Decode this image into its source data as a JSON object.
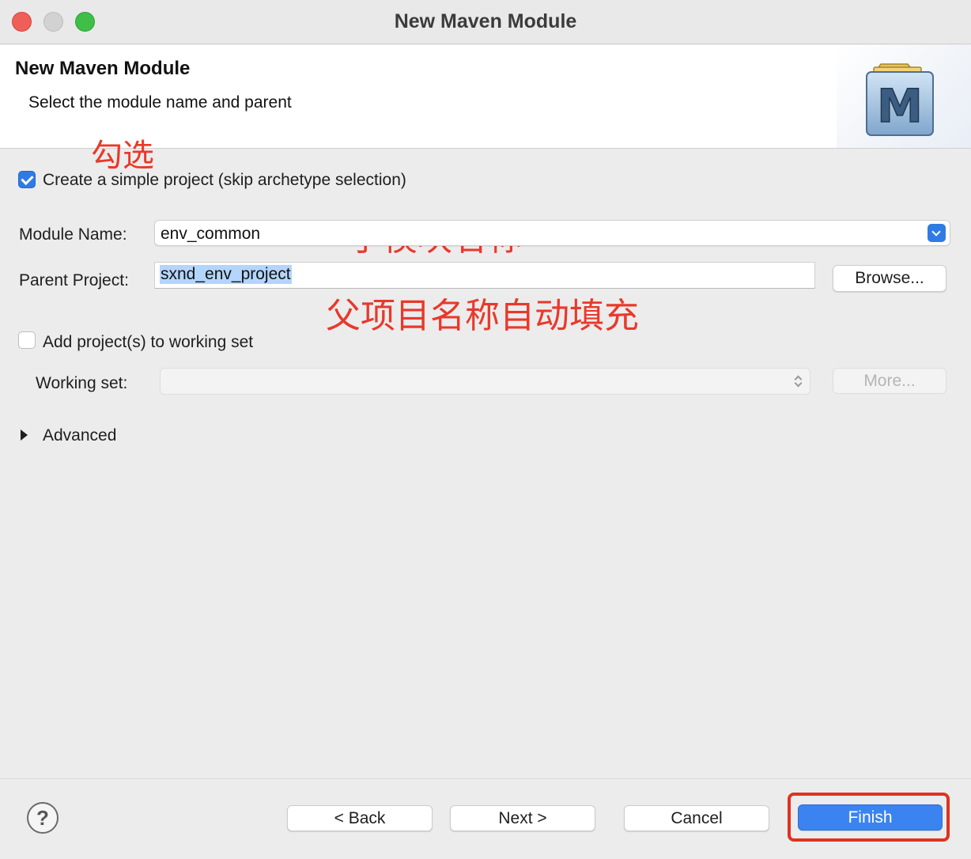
{
  "window": {
    "title": "New Maven Module"
  },
  "header": {
    "title": "New Maven Module",
    "subtitle": "Select the module name and parent",
    "icon": "maven-module-icon",
    "icon_letter": "M"
  },
  "annotations": {
    "check_hint": "勾选",
    "module_hint": "子模块名称",
    "parent_hint": "父项目名称自动填充"
  },
  "form": {
    "simple_project": {
      "label": "Create a simple project (skip archetype selection)",
      "checked": true
    },
    "module_name": {
      "label": "Module Name:",
      "value": "env_common"
    },
    "parent_project": {
      "label": "Parent Project:",
      "value": "sxnd_env_project",
      "browse_label": "Browse..."
    },
    "working_set_checkbox": {
      "label": "Add project(s) to working set",
      "checked": false
    },
    "working_set": {
      "label": "Working set:",
      "value": "",
      "more_label": "More..."
    },
    "advanced": {
      "label": "Advanced",
      "expanded": false
    }
  },
  "footer": {
    "help_icon": "?",
    "back_label": "< Back",
    "next_label": "Next >",
    "cancel_label": "Cancel",
    "finish_label": "Finish"
  },
  "colors": {
    "accent": "#3b83f0",
    "annotation": "#e8392b",
    "background": "#ececec"
  }
}
